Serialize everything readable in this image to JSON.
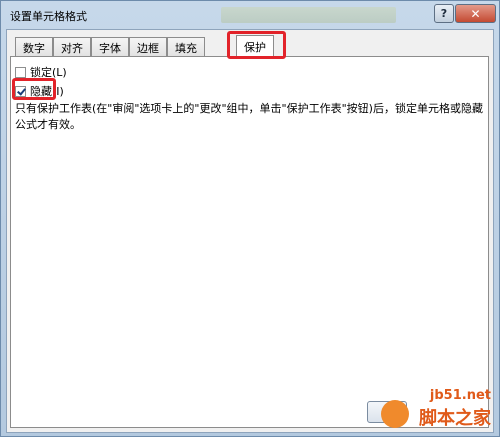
{
  "window": {
    "title": "设置单元格格式"
  },
  "titlebar": {
    "help_label": "?",
    "close_label": "✕"
  },
  "tabs": [
    {
      "label": "数字"
    },
    {
      "label": "对齐"
    },
    {
      "label": "字体"
    },
    {
      "label": "边框"
    },
    {
      "label": "填充"
    },
    {
      "label": "保护",
      "active": true
    }
  ],
  "protection": {
    "locked": {
      "label": "锁定(L)",
      "checked": false
    },
    "hidden": {
      "label": "隐藏(I)",
      "checked": true
    },
    "description": "只有保护工作表(在\"审阅\"选项卡上的\"更改\"组中，单击\"保护工作表\"按钮)后，锁定单元格或隐藏公式才有效。"
  },
  "watermark": {
    "url": "jb51.net",
    "name": "脚本之家"
  },
  "colors": {
    "highlight": "#e2232a",
    "watermark": "#e05a1a"
  }
}
